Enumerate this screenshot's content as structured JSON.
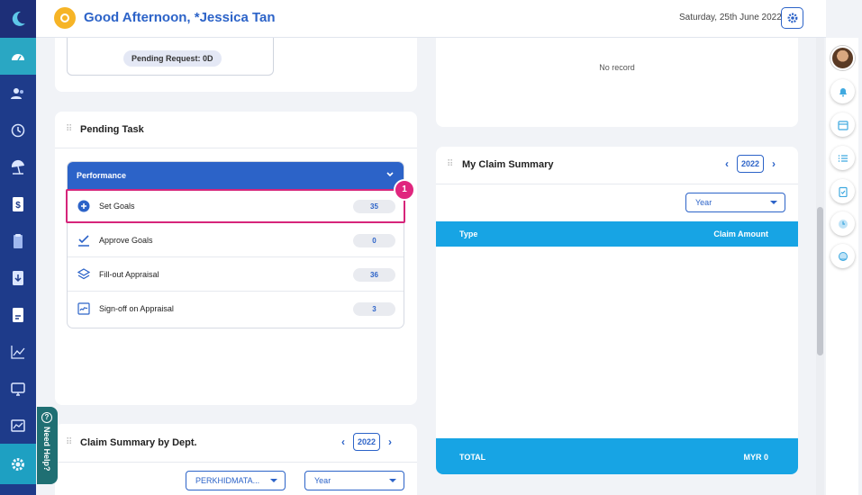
{
  "header": {
    "greeting": "Good Afternoon, *Jessica Tan",
    "date": "Saturday, 25th June 2022"
  },
  "leave_card": {
    "pending_request": "Pending Request: 0D"
  },
  "top_right_card": {
    "no_record": "No record"
  },
  "pending_task": {
    "title": "Pending Task",
    "group_label": "Performance",
    "tasks": [
      {
        "label": "Set Goals",
        "count": "35",
        "icon": "plus-circle-icon"
      },
      {
        "label": "Approve Goals",
        "count": "0",
        "icon": "check-underline-icon"
      },
      {
        "label": "Fill-out Appraisal",
        "count": "36",
        "icon": "layers-icon"
      },
      {
        "label": "Sign-off on Appraisal",
        "count": "3",
        "icon": "signature-icon"
      }
    ],
    "step_badge": "1"
  },
  "claim_summary": {
    "title": "My Claim Summary",
    "year": "2022",
    "filter": "Year",
    "col_type": "Type",
    "col_amount": "Claim Amount",
    "total_label": "TOTAL",
    "total_value": "MYR 0"
  },
  "dept_summary": {
    "title": "Claim Summary by Dept.",
    "year": "2022",
    "dept_filter": "PERKHIDMATA...",
    "period_filter": "Year"
  },
  "need_help": "Need Help?",
  "colors": {
    "primary": "#2c63c8",
    "sidebar": "#1e3b8a",
    "accent_cyan": "#17a4e4",
    "highlight": "#d6257a"
  }
}
